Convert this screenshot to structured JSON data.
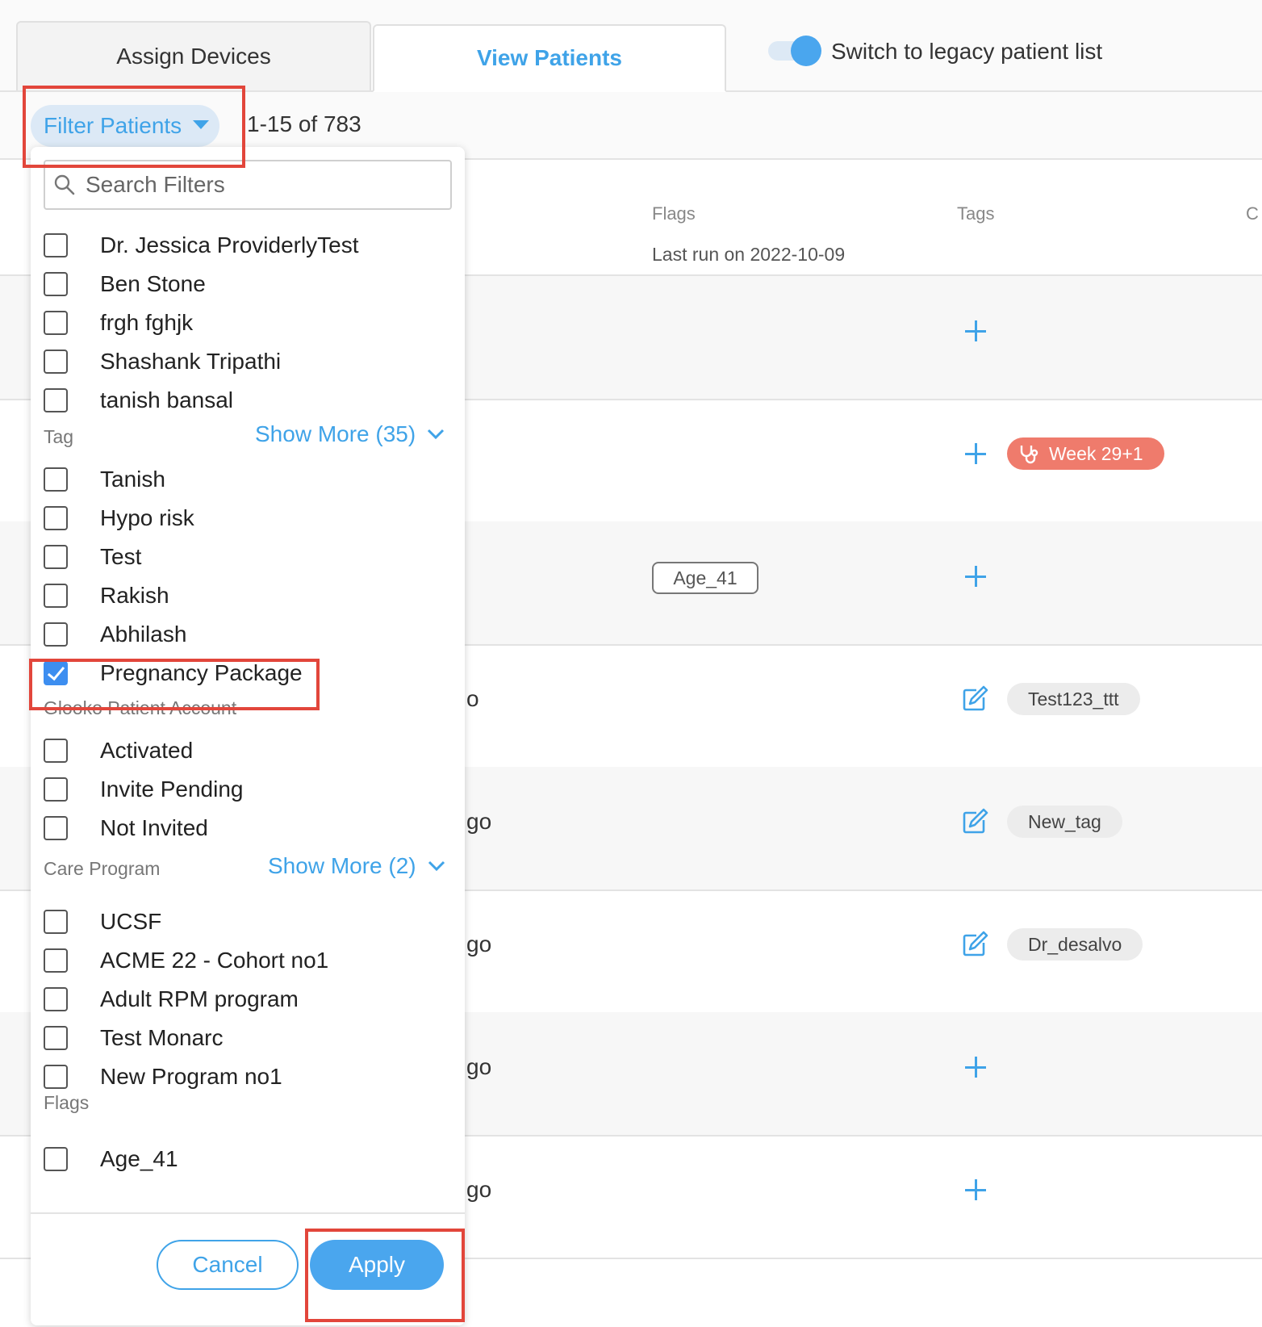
{
  "tabs": {
    "assign": "Assign Devices",
    "view": "View Patients"
  },
  "legacy_toggle": {
    "label": "Switch to legacy patient list",
    "on": true
  },
  "filter_button": {
    "label": "Filter Patients"
  },
  "pagination": {
    "label": "1-15 of 783"
  },
  "table": {
    "headers": {
      "flags": "Flags",
      "tags": "Tags",
      "more": "C"
    },
    "last_run": "Last run on 2022-10-09",
    "rows": [
      {
        "partial_text": "",
        "flag": "",
        "tag_action": "add",
        "tags": []
      },
      {
        "partial_text": "",
        "flag": "",
        "tag_action": "add",
        "tags": [
          "Week 29+1"
        ]
      },
      {
        "partial_text": "",
        "flag": "Age_41",
        "tag_action": "add",
        "tags": []
      },
      {
        "partial_text": "o",
        "flag": "",
        "tag_action": "edit",
        "tags": [
          "Test123_ttt"
        ]
      },
      {
        "partial_text": "go",
        "flag": "",
        "tag_action": "edit",
        "tags": [
          "New_tag"
        ]
      },
      {
        "partial_text": "go",
        "flag": "",
        "tag_action": "edit",
        "tags": [
          "Dr_desalvo"
        ]
      },
      {
        "partial_text": "go",
        "flag": "",
        "tag_action": "add",
        "tags": []
      },
      {
        "partial_text": "go",
        "flag": "",
        "tag_action": "add",
        "tags": []
      }
    ]
  },
  "filter_panel": {
    "search_placeholder": "Search Filters",
    "providers": [
      {
        "label": "Dr. Jessica ProviderlyTest",
        "checked": false
      },
      {
        "label": "Ben Stone",
        "checked": false
      },
      {
        "label": "frgh fghjk",
        "checked": false
      },
      {
        "label": "Shashank Tripathi",
        "checked": false
      },
      {
        "label": "tanish bansal",
        "checked": false
      }
    ],
    "tag": {
      "title": "Tag",
      "show_more": "Show More (35)",
      "options": [
        {
          "label": "Tanish",
          "checked": false
        },
        {
          "label": "Hypo risk",
          "checked": false
        },
        {
          "label": "Test",
          "checked": false
        },
        {
          "label": "Rakish",
          "checked": false
        },
        {
          "label": "Abhilash",
          "checked": false
        },
        {
          "label": "Pregnancy Package",
          "checked": true
        }
      ]
    },
    "account": {
      "title": "Glooko Patient Account",
      "options": [
        {
          "label": "Activated",
          "checked": false
        },
        {
          "label": "Invite Pending",
          "checked": false
        },
        {
          "label": "Not Invited",
          "checked": false
        }
      ]
    },
    "care_program": {
      "title": "Care Program",
      "show_more": "Show More (2)",
      "options": [
        {
          "label": "UCSF",
          "checked": false
        },
        {
          "label": "ACME 22 - Cohort no1",
          "checked": false
        },
        {
          "label": "Adult RPM program",
          "checked": false
        },
        {
          "label": "Test Monarc",
          "checked": false
        },
        {
          "label": "New Program no1",
          "checked": false
        }
      ]
    },
    "flags": {
      "title": "Flags",
      "options": [
        {
          "label": "Age_41",
          "checked": false
        }
      ]
    },
    "cancel_label": "Cancel",
    "apply_label": "Apply"
  },
  "colors": {
    "accent": "#3fa3e8",
    "highlight": "#e2463b",
    "tag_pink": "#ef7b6c"
  }
}
